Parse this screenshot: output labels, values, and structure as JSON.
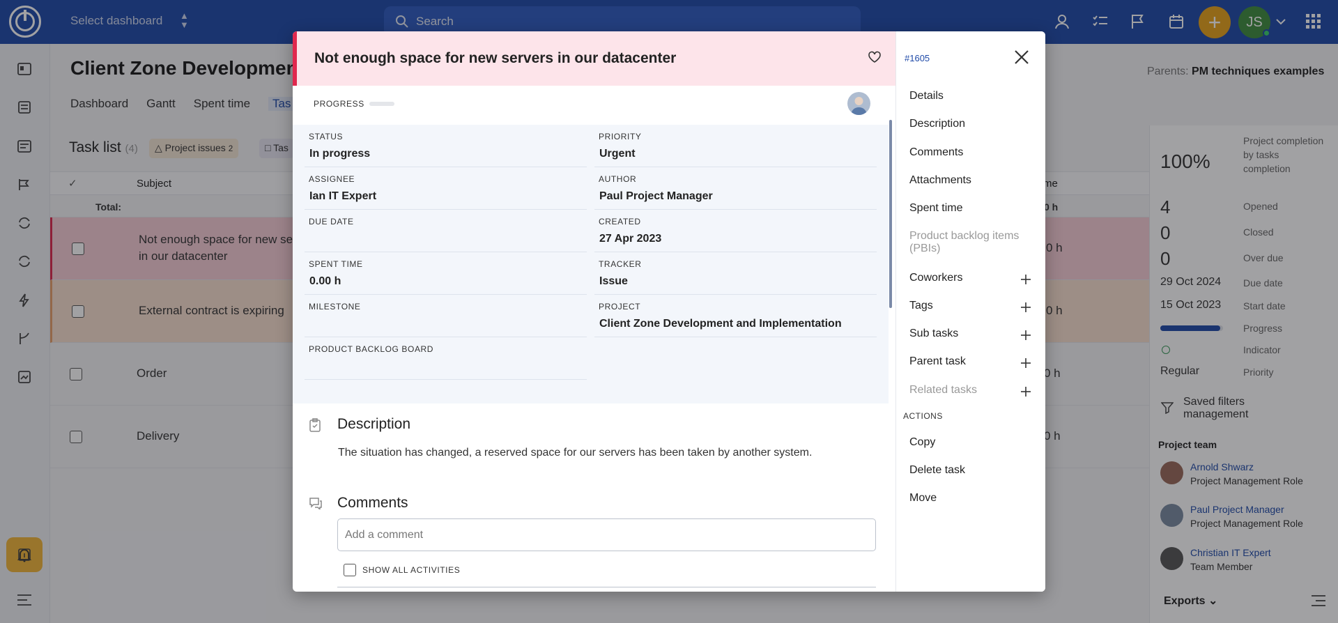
{
  "topbar": {
    "dashboard_select": "Select dashboard",
    "search_placeholder": "Search",
    "user_initials": "JS"
  },
  "page": {
    "title": "Client Zone Development",
    "parents_label": "Parents:",
    "parents_value": "PM techniques examples",
    "tabs": [
      {
        "label": "Dashboard"
      },
      {
        "label": "Gantt"
      },
      {
        "label": "Spent time"
      },
      {
        "label": "Tas"
      }
    ],
    "list": {
      "title": "Task list",
      "count": "(4)",
      "chip1": "Project issues",
      "chip1_count": "2",
      "chip2": "Tas",
      "col_subject": "Subject",
      "col_time": "me",
      "total_label": "Total:",
      "total_value": "0 h",
      "rows": [
        {
          "subject_line1": "Not enough space for new ser",
          "subject_line2": "in our datacenter",
          "time": "0 h"
        },
        {
          "subject_line1": "External contract is expiring",
          "subject_line2": "",
          "time": "0 h"
        },
        {
          "subject_line1": "Order",
          "subject_line2": "",
          "time": "0 h"
        },
        {
          "subject_line1": "Delivery",
          "subject_line2": "",
          "time": "0 h"
        }
      ]
    }
  },
  "sidebar": {
    "completion": "100%",
    "completion_label": "Project completion by tasks completion",
    "opened": "4",
    "opened_label": "Opened",
    "closed": "0",
    "closed_label": "Closed",
    "overdue": "0",
    "overdue_label": "Over due",
    "due_date": "29 Oct 2024",
    "due_date_label": "Due date",
    "start_date": "15 Oct 2023",
    "start_date_label": "Start date",
    "progress_label": "Progress",
    "progress_fraction": 0.95,
    "indicator_label": "Indicator",
    "priority_value": "Regular",
    "priority_label": "Priority",
    "saved_filters": "Saved filters management",
    "project_team": "Project team",
    "team": [
      {
        "name": "Arnold Shwarz",
        "role": "Project Management Role"
      },
      {
        "name": "Paul Project Manager",
        "role": "Project Management Role"
      },
      {
        "name": "Christian IT Expert",
        "role": "Team Member"
      }
    ],
    "exports": "Exports"
  },
  "modal": {
    "title": "Not enough space for new servers in our datacenter",
    "id": "#1605",
    "progress_label": "PROGRESS",
    "fields": {
      "status_label": "STATUS",
      "status": "In progress",
      "priority_label": "PRIORITY",
      "priority": "Urgent",
      "assignee_label": "ASSIGNEE",
      "assignee": "Ian IT Expert",
      "author_label": "AUTHOR",
      "author": "Paul Project Manager",
      "due_date_label": "DUE DATE",
      "due_date": "",
      "created_label": "CREATED",
      "created": "27 Apr 2023",
      "spent_time_label": "SPENT TIME",
      "spent_time": "0.00 h",
      "tracker_label": "TRACKER",
      "tracker": "Issue",
      "milestone_label": "MILESTONE",
      "milestone": "",
      "project_label": "PROJECT",
      "project": "Client Zone Development and Implementation",
      "pbb_label": "PRODUCT BACKLOG BOARD",
      "pbb": ""
    },
    "description_title": "Description",
    "description_text": "The situation has changed, a reserved space for our servers has been taken by another system.",
    "comments_title": "Comments",
    "comment_placeholder": "Add a comment",
    "show_all_activities": "SHOW ALL ACTIVITIES",
    "side": {
      "details": "Details",
      "description": "Description",
      "comments": "Comments",
      "attachments": "Attachments",
      "spent_time": "Spent time",
      "pbi": "Product backlog items (PBIs)",
      "coworkers": "Coworkers",
      "tags": "Tags",
      "sub_tasks": "Sub tasks",
      "parent_task": "Parent task",
      "related_tasks": "Related tasks",
      "actions_label": "ACTIONS",
      "copy": "Copy",
      "delete_task": "Delete task",
      "move": "Move"
    }
  }
}
